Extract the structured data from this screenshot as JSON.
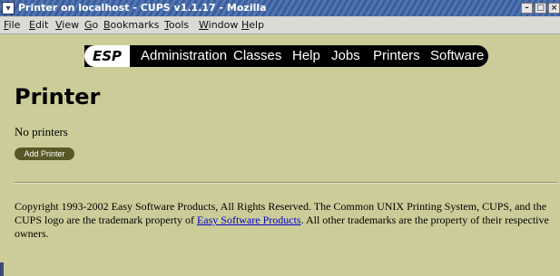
{
  "window": {
    "title": "Printer on localhost - CUPS v1.1.17 - Mozilla",
    "menu_glyph": "▾",
    "minimize_glyph": "–",
    "maximize_glyph": "□",
    "close_glyph": "×"
  },
  "menubar": {
    "items": [
      "File",
      "Edit",
      "View",
      "Go",
      "Bookmarks",
      "Tools",
      "Window",
      "Help"
    ]
  },
  "navbar": {
    "logo": "ESP",
    "items": [
      "Administration",
      "Classes",
      "Help",
      "Jobs",
      "Printers",
      "Software"
    ]
  },
  "page": {
    "title": "Printer",
    "status_text": "No printers",
    "add_button_label": "Add Printer"
  },
  "footer": {
    "text_before_link": "Copyright 1993-2002 Easy Software Products, All Rights Reserved. The Common UNIX Printing System, CUPS, and the CUPS logo are the trademark property of ",
    "link_text": "Easy Software Products",
    "text_after_link": ". All other trademarks are the property of their respective owners."
  },
  "colors": {
    "page_background": "#cccc99",
    "nav_background": "#000000",
    "button_background": "#585827",
    "link": "#0000cc",
    "titlebar": "#3b5e9a"
  }
}
